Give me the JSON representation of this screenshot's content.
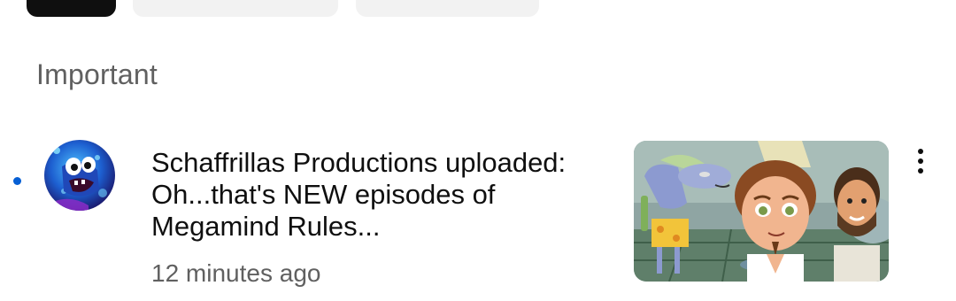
{
  "section": {
    "header": "Important"
  },
  "notification": {
    "title": "Schaffrillas Productions uploaded: Oh...that's NEW episodes of Megamind Rules...",
    "time": "12 minutes ago",
    "unread": true
  },
  "icons": {
    "avatar": "channel-avatar",
    "thumbnail": "video-thumbnail",
    "more": "more-vert-icon"
  },
  "colors": {
    "unread_dot": "#065fd4",
    "text_primary": "#0f0f0f",
    "text_secondary": "#606060",
    "chip_selected": "#0f0f0f",
    "chip_default": "#f2f2f2"
  }
}
